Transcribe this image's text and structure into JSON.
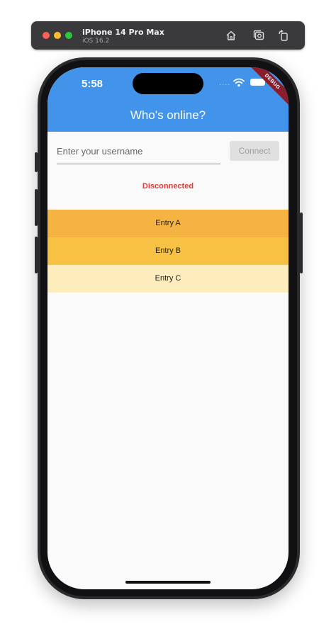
{
  "simulator": {
    "device_name": "iPhone 14 Pro Max",
    "os_version": "iOS 16.2",
    "traffic_lights": [
      "#ff5f57",
      "#febc2e",
      "#28c840"
    ],
    "toolbar_icons": [
      "home-icon",
      "screenshot-icon",
      "rotate-icon"
    ]
  },
  "status_bar": {
    "time": "5:58",
    "signal": "....",
    "icons": [
      "wifi-icon",
      "battery-icon"
    ]
  },
  "debug_banner": "DEBUG",
  "app_bar": {
    "title": "Who's online?",
    "color": "#4293ea"
  },
  "username_field": {
    "value": "",
    "placeholder": "Enter your username"
  },
  "connect_button": {
    "label": "Connect",
    "enabled": false
  },
  "connection_status": {
    "text": "Disconnected",
    "color": "#e53935"
  },
  "entries": [
    {
      "label": "Entry A",
      "color": "#f5b342"
    },
    {
      "label": "Entry B",
      "color": "#f7c144"
    },
    {
      "label": "Entry C",
      "color": "#fdedbc"
    }
  ]
}
